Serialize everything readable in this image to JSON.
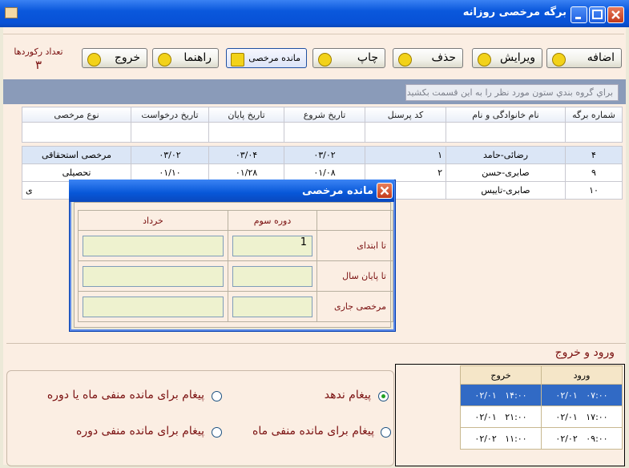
{
  "window": {
    "title": "برگه مرخصی روزانه"
  },
  "toolbar": {
    "add": "اضافه",
    "edit": "ویرایش",
    "delete": "حذف",
    "print": "چاپ",
    "leave_balance": "مانده مرخصی",
    "help": "راهنما",
    "exit": "خروج",
    "record_count_label": "تعداد رکوردها",
    "record_count": "۳"
  },
  "grid": {
    "group_hint": "براي گروه بندي ستون مورد نظر را به اين قسمت بكشيد.",
    "columns": [
      "شماره برگه",
      "نام خانوادگی و نام",
      "کد پرسنل",
      "تاریخ شروع",
      "تاریخ پایان",
      "تاریخ درخواست",
      "نوع مرخصی"
    ],
    "rows": [
      [
        "۴",
        "رضائی-حامد",
        "۱",
        "۰۳/۰۲",
        "۰۳/۰۴",
        "۰۳/۰۲",
        "مرخصی استحقاقی"
      ],
      [
        "۹",
        "صابری-حسن",
        "۲",
        "۰۱/۰۸",
        "۰۱/۲۸",
        "۰۱/۱۰",
        "تحصیلی"
      ],
      [
        "۱۰",
        "صابری-تاییس",
        "",
        "",
        "",
        "",
        "ی"
      ]
    ]
  },
  "dialog": {
    "title": "مانده مرخصی",
    "col_period": "دوره سوم",
    "col_month": "خرداد",
    "row_start": "تا ابتدای",
    "row_year_end": "تا پایان سال",
    "row_current": "مرخصی جاری",
    "start_value": "1"
  },
  "io": {
    "title": "ورود و خروج",
    "col_in": "ورود",
    "col_out": "خروج",
    "rows": [
      {
        "in_date": "۰۲/۰۱",
        "in_time": "۰۷:۰۰",
        "out_date": "۰۲/۰۱",
        "out_time": "۱۴:۰۰"
      },
      {
        "in_date": "۰۲/۰۱",
        "in_time": "۱۷:۰۰",
        "out_date": "۰۲/۰۱",
        "out_time": "۲۱:۰۰"
      },
      {
        "in_date": "۰۲/۰۲",
        "in_time": "۰۹:۰۰",
        "out_date": "۰۲/۰۲",
        "out_time": "۱۱:۰۰"
      }
    ]
  },
  "options": {
    "no_message": "پیغام ندهد",
    "msg_negative_month_period": "پیغام برای مانده منفی ماه یا دوره",
    "msg_negative_month": "پیغام برای مانده منفی ماه",
    "msg_negative_period": "پیغام برای مانده منفی دوره"
  }
}
